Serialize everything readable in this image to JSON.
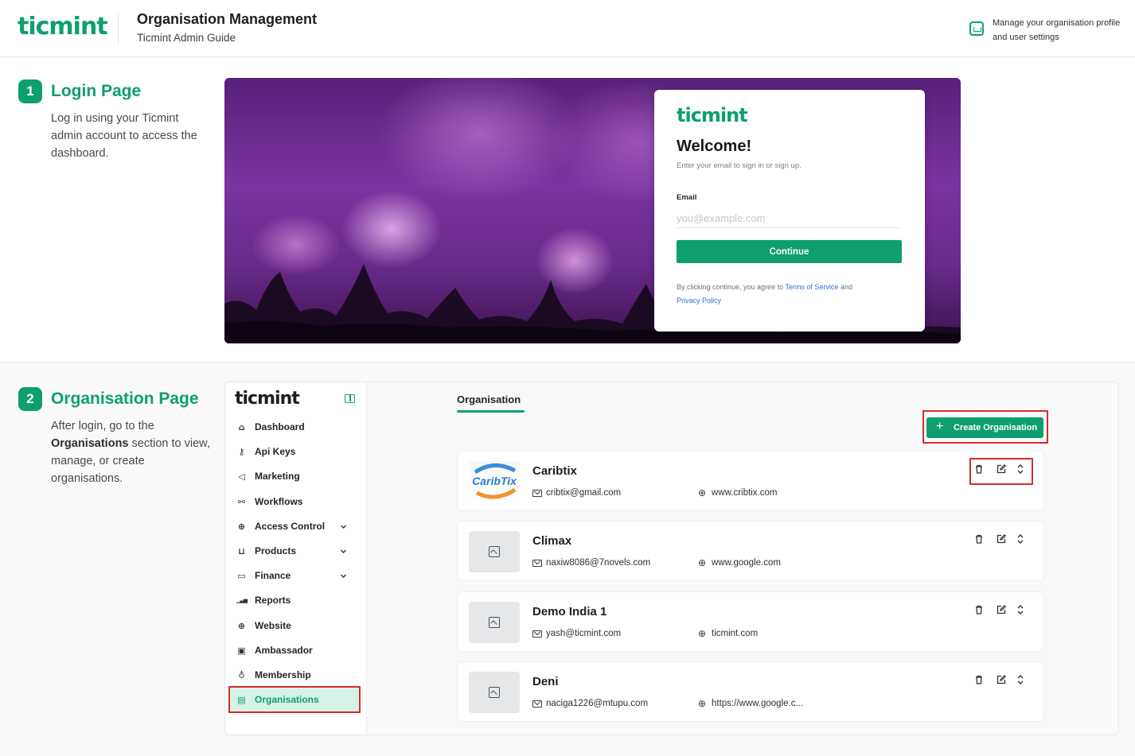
{
  "header": {
    "logo": "ticmint",
    "title": "Organisation Management",
    "subtitle": "Ticmint Admin Guide",
    "note": "Manage your organisation profile and user settings"
  },
  "steps": [
    {
      "number": "1",
      "title": "Login Page",
      "description": "Log in using your Ticmint admin account to access the dashboard."
    },
    {
      "number": "2",
      "title": "Organisation Page",
      "description_pre": "After login, go to the ",
      "description_bold": "Organisations",
      "description_post": " section to view, manage, or create organisations."
    }
  ],
  "login": {
    "logo": "ticmint",
    "welcome": "Welcome!",
    "subtitle": "Enter your email to sign in or sign up.",
    "email_label": "Email",
    "email_placeholder": "you@example.com",
    "continue_label": "Continue",
    "terms_pre": "By clicking continue, you agree to ",
    "terms_link": "Terms of Service",
    "terms_mid": " and",
    "privacy_link": "Privacy Policy"
  },
  "sidebar": {
    "logo": "ticmint",
    "items": [
      {
        "label": "Dashboard",
        "icon": "home-icon",
        "glyph": "⌂"
      },
      {
        "label": "Api Keys",
        "icon": "key-icon",
        "glyph": "⚷"
      },
      {
        "label": "Marketing",
        "icon": "megaphone-icon",
        "glyph": "◁"
      },
      {
        "label": "Workflows",
        "icon": "workflow-icon",
        "glyph": "⚯"
      },
      {
        "label": "Access Control",
        "icon": "globe-icon",
        "glyph": "⊕",
        "expandable": true
      },
      {
        "label": "Products",
        "icon": "cart-icon",
        "glyph": "⊔",
        "expandable": true
      },
      {
        "label": "Finance",
        "icon": "wallet-icon",
        "glyph": "▭",
        "expandable": true
      },
      {
        "label": "Reports",
        "icon": "bar-chart-icon",
        "glyph": "▁▃▅"
      },
      {
        "label": "Website",
        "icon": "globe-icon",
        "glyph": "⊕"
      },
      {
        "label": "Ambassador",
        "icon": "id-badge-icon",
        "glyph": "▣"
      },
      {
        "label": "Membership",
        "icon": "award-icon",
        "glyph": "♁"
      },
      {
        "label": "Organisations",
        "icon": "building-icon",
        "glyph": "▤",
        "active": true
      }
    ]
  },
  "main": {
    "tab": "Organisation",
    "create_label": "Create Organisation",
    "organisations": [
      {
        "name": "Caribtix",
        "email": "cribtix@gmail.com",
        "website": "www.cribtix.com",
        "thumb": "logo",
        "logo_text": "CaribTix"
      },
      {
        "name": "Climax",
        "email": "naxiw8086@7novels.com",
        "website": "www.google.com",
        "thumb": "placeholder"
      },
      {
        "name": "Demo India 1",
        "email": "yash@ticmint.com",
        "website": "ticmint.com",
        "thumb": "placeholder"
      },
      {
        "name": "Deni",
        "email": "naciga1226@mtupu.com",
        "website": "https://www.google.c...",
        "thumb": "placeholder"
      }
    ]
  },
  "colors": {
    "brand": "#0e9f6e",
    "highlight": "#d42b2b",
    "active_nav_bg": "#d7f2e6"
  }
}
